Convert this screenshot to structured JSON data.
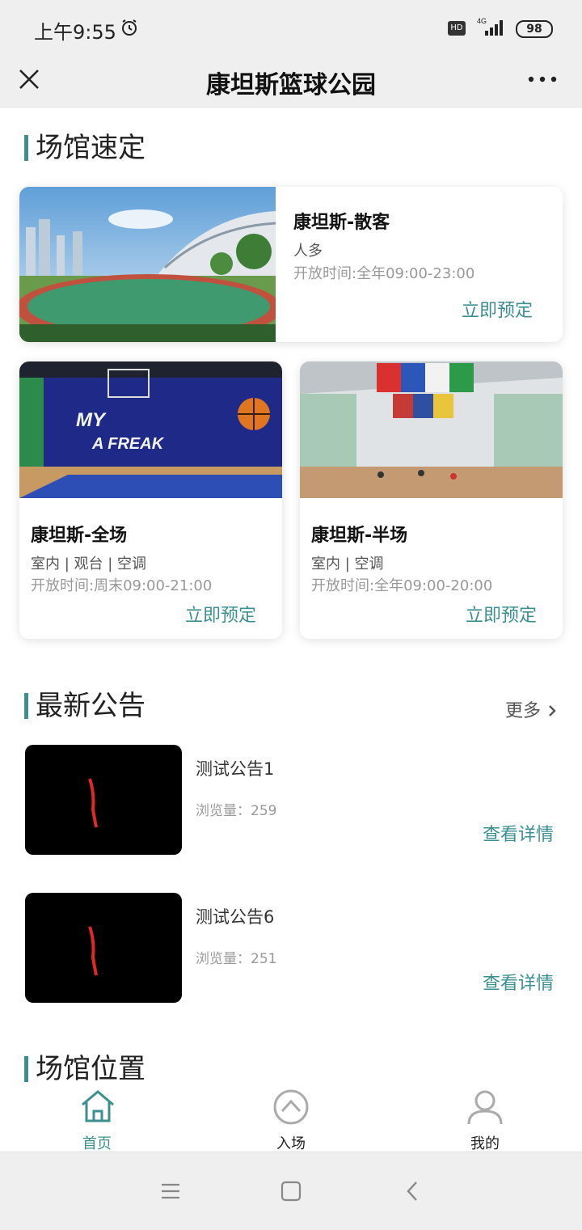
{
  "status": {
    "time": "上午9:55",
    "hd": "HD",
    "network": "4G",
    "battery": "98"
  },
  "nav": {
    "title": "康坦斯篮球公园"
  },
  "booking": {
    "section_title": "场馆速定",
    "venues": [
      {
        "name": "康坦斯-散客",
        "tags": "人多",
        "hours": "开放时间:全年09:00-23:00",
        "book": "立即预定"
      },
      {
        "name": "康坦斯-全场",
        "tags": "室内 | 观台 | 空调",
        "hours": "开放时间:周末09:00-21:00",
        "book": "立即预定"
      },
      {
        "name": "康坦斯-半场",
        "tags": "室内 | 空调",
        "hours": "开放时间:全年09:00-20:00",
        "book": "立即预定"
      }
    ]
  },
  "notices": {
    "section_title": "最新公告",
    "more": "更多",
    "items": [
      {
        "title": "测试公告1",
        "views": "浏览量：259",
        "detail": "查看详情"
      },
      {
        "title": "测试公告6",
        "views": "浏览量：251",
        "detail": "查看详情"
      }
    ]
  },
  "location": {
    "section_title": "场馆位置"
  },
  "tabbar": {
    "active_color": "#3b8f90",
    "tabs": [
      {
        "label": "首页",
        "icon": "home-icon"
      },
      {
        "label": "入场",
        "icon": "chevron-up-circle-icon"
      },
      {
        "label": "我的",
        "icon": "user-icon"
      }
    ]
  },
  "colors": {
    "accent": "#3b8f90",
    "background": "#efefef"
  }
}
